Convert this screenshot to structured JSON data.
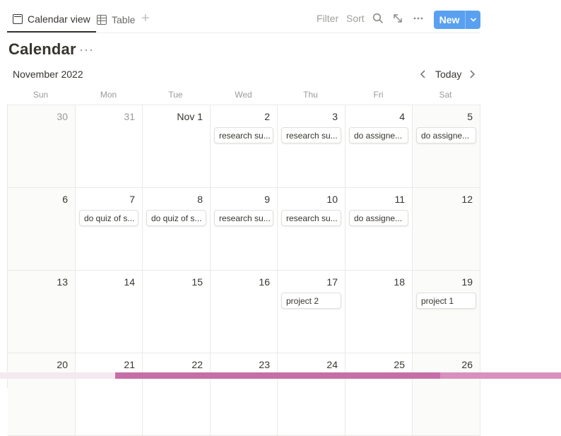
{
  "tabs": [
    {
      "label": "Calendar view",
      "icon": "calendar-icon",
      "active": true
    },
    {
      "label": "Table",
      "icon": "table-icon",
      "active": false
    }
  ],
  "toolbar": {
    "filter": "Filter",
    "sort": "Sort",
    "new_label": "New",
    "accent": "#5aa0f0"
  },
  "page": {
    "title": "Calendar",
    "month": "November 2022",
    "today": "Today"
  },
  "weekdays": [
    "Sun",
    "Mon",
    "Tue",
    "Wed",
    "Thu",
    "Fri",
    "Sat"
  ],
  "weeks": [
    [
      {
        "day": "30",
        "muted": true
      },
      {
        "day": "31",
        "muted": true
      },
      {
        "day": "Nov 1"
      },
      {
        "day": "2",
        "event": "research su..."
      },
      {
        "day": "3",
        "event": "research su..."
      },
      {
        "day": "4",
        "event": "do assigne..."
      },
      {
        "day": "5",
        "event": "do assigne..."
      }
    ],
    [
      {
        "day": "6"
      },
      {
        "day": "7",
        "event": "do quiz of s..."
      },
      {
        "day": "8",
        "event": "do quiz of s..."
      },
      {
        "day": "9",
        "event": "research su..."
      },
      {
        "day": "10",
        "event": "research su..."
      },
      {
        "day": "11",
        "event": "do assigne..."
      },
      {
        "day": "12"
      }
    ],
    [
      {
        "day": "13"
      },
      {
        "day": "14"
      },
      {
        "day": "15"
      },
      {
        "day": "16"
      },
      {
        "day": "17",
        "event": "project 2"
      },
      {
        "day": "18"
      },
      {
        "day": "19",
        "event": "project 1"
      }
    ],
    [
      {
        "day": "20"
      },
      {
        "day": "21"
      },
      {
        "day": "22"
      },
      {
        "day": "23"
      },
      {
        "day": "24"
      },
      {
        "day": "25"
      },
      {
        "day": "26"
      }
    ]
  ]
}
